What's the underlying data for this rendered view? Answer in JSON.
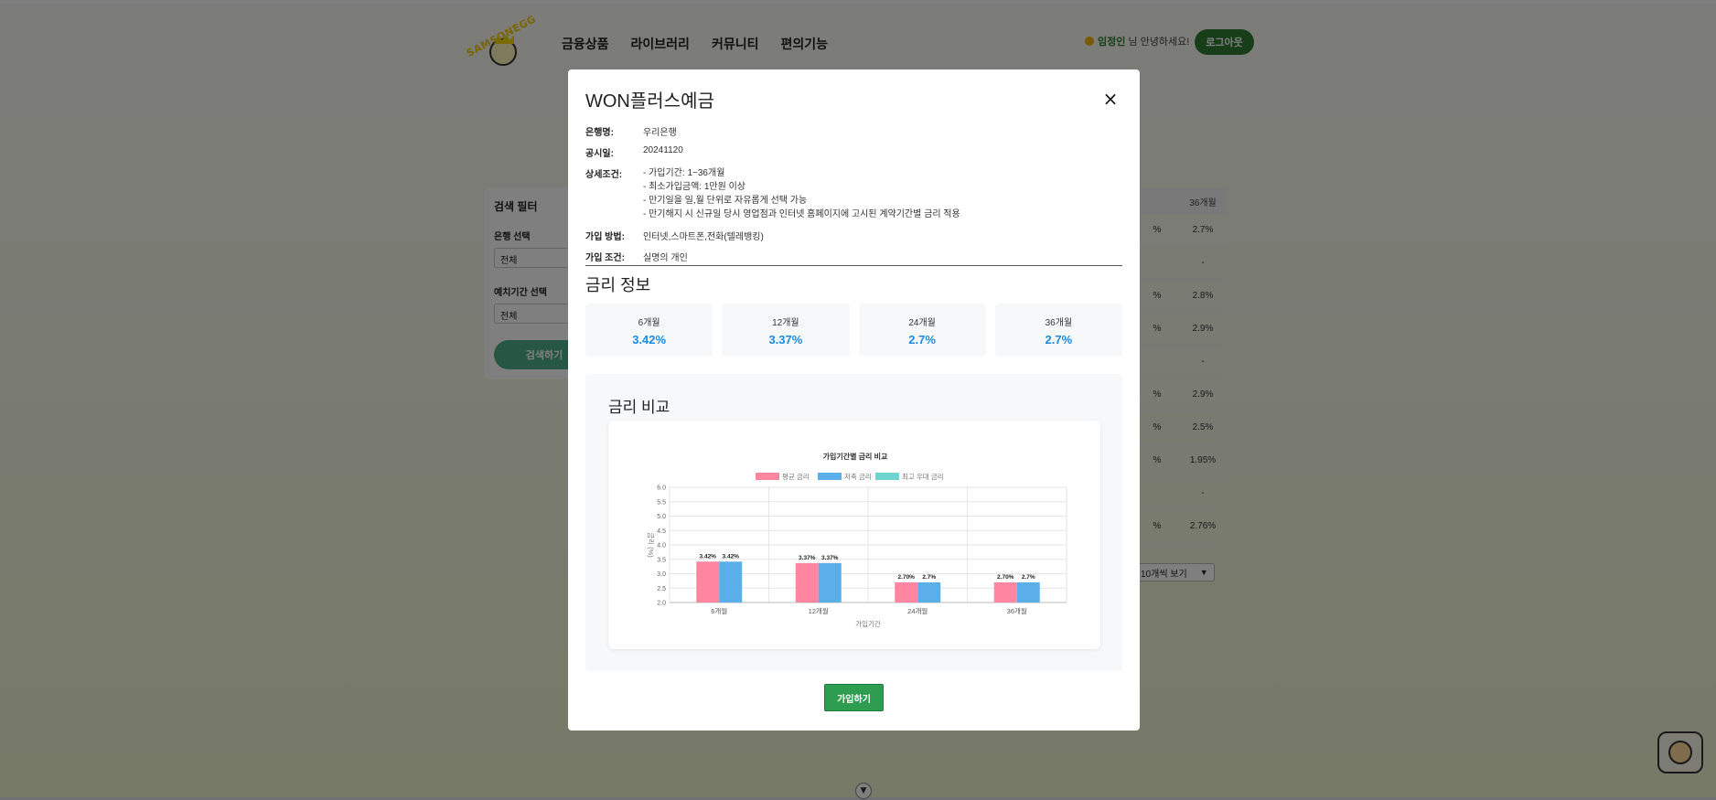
{
  "header": {
    "logo_text": "SAMSONEGG",
    "nav": [
      "금융상품",
      "라이브러리",
      "커뮤니티",
      "편의기능"
    ],
    "user_name": "임정인",
    "greeting_suffix": " 님 안녕하세요!",
    "logout_label": "로그아웃"
  },
  "filter": {
    "title": "검색 필터",
    "bank_label": "은행 선택",
    "bank_value": "전체",
    "term_label": "예치기간 선택",
    "term_value": "전체",
    "search_label": "검색하기"
  },
  "background_table": {
    "header": [
      "",
      "36개월"
    ],
    "rows": [
      [
        "%",
        "2.7%"
      ],
      [
        "",
        "-"
      ],
      [
        "%",
        "2.8%"
      ],
      [
        "%",
        "2.9%"
      ],
      [
        "",
        "-"
      ],
      [
        "%",
        "2.9%"
      ],
      [
        "%",
        "2.5%"
      ],
      [
        "%",
        "1.95%"
      ],
      [
        "",
        "-"
      ],
      [
        "%",
        "2.76%"
      ]
    ],
    "per_page_label": "10개씩 보기"
  },
  "modal": {
    "title": "WON플러스예금",
    "close_label": "×",
    "info": {
      "bank_label": "은행명:",
      "bank_value": "우리은행",
      "date_label": "공시일:",
      "date_value": "20241120",
      "cond_label": "상세조건:",
      "cond_lines": [
        "- 가입기간: 1~36개월",
        "- 최소가입금액: 1만원 이상",
        "- 만기일을 일,월 단위로 자유롭게 선택 가능",
        "- 만기해지 시 신규일 당시 영업점과 인터넷 홈페이지에 고시된 계약기간별 금리 적용"
      ],
      "method_label": "가입 방법:",
      "method_value": "인터넷,스마트폰,전화(텔레뱅킹)",
      "target_label": "가입 조건:",
      "target_value": "실명의 개인"
    },
    "rate_section_title": "금리 정보",
    "rates": [
      {
        "term": "6개월",
        "rate": "3.42%"
      },
      {
        "term": "12개월",
        "rate": "3.37%"
      },
      {
        "term": "24개월",
        "rate": "2.7%"
      },
      {
        "term": "36개월",
        "rate": "2.7%"
      }
    ],
    "compare_title": "금리 비교",
    "join_label": "가입하기"
  },
  "colors": {
    "avg_rate": "#ff85a1",
    "save_rate": "#5aaeea",
    "max_rate": "#6fd3cf",
    "accent_green": "#2e7d32",
    "rate_blue": "#1a8ce3"
  },
  "chart_data": {
    "type": "bar",
    "title": "가입기간별 금리 비교",
    "xlabel": "가입기간",
    "ylabel": "금리 (%)",
    "categories": [
      "6개월",
      "12개월",
      "24개월",
      "36개월"
    ],
    "series": [
      {
        "name": "평균 금리",
        "values": [
          3.42,
          3.37,
          2.7,
          2.7
        ],
        "labels": [
          "3.42%",
          "3.37%",
          "2.70%",
          "2.70%"
        ]
      },
      {
        "name": "저축 금리",
        "values": [
          3.42,
          3.37,
          2.7,
          2.7
        ],
        "labels": [
          "3.42%",
          "3.37%",
          "2.7%",
          "2.7%"
        ]
      },
      {
        "name": "최고 우대 금리",
        "values": [],
        "labels": []
      }
    ],
    "ylim": [
      2.0,
      6.0
    ],
    "yticks": [
      "2.0",
      "2.5",
      "3.0",
      "3.5",
      "4.0",
      "4.5",
      "5.0",
      "5.5",
      "6.0"
    ],
    "grid": true,
    "legend": "top"
  }
}
